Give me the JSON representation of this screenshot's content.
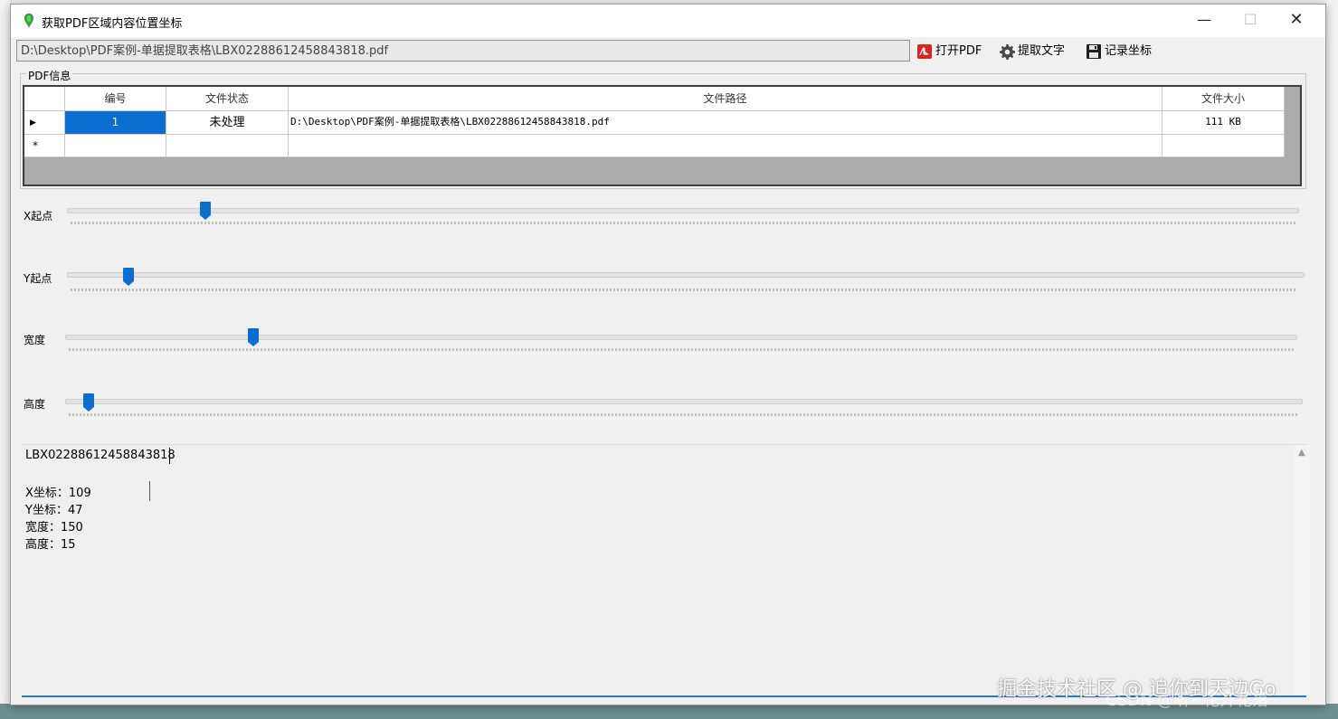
{
  "window": {
    "title": "获取PDF区域内容位置坐标",
    "minimize": "—",
    "maximize": "☐",
    "close": "✕"
  },
  "toolbar": {
    "path_value": "D:\\Desktop\\PDF案例-单据提取表格\\LBX02288612458843818.pdf",
    "open_label": "打开PDF",
    "extract_label": "提取文字",
    "record_label": "记录坐标"
  },
  "pdf_group": {
    "label": "PDF信息",
    "columns": [
      "编号",
      "文件状态",
      "文件路径",
      "文件大小"
    ],
    "rows": [
      {
        "id": "1",
        "status": "未处理",
        "path": "D:\\Desktop\\PDF案例-单据提取表格\\LBX02288612458843818.pdf",
        "size": "111 KB"
      }
    ],
    "new_row_marker": "*",
    "current_row_marker": "▶"
  },
  "sliders": {
    "x": {
      "label": "X起点",
      "value_fraction": 0.11
    },
    "y": {
      "label": "Y起点",
      "value_fraction": 0.05
    },
    "width": {
      "label": "宽度",
      "value_fraction": 0.15
    },
    "height": {
      "label": "高度",
      "value_fraction": 0.02
    }
  },
  "output": {
    "filename": "LBX02288612458843818",
    "lines": [
      "X坐标：109",
      "Y坐标：47",
      "宽度：150",
      "高度：15"
    ]
  },
  "watermark": {
    "text": "掘金技术社区 @ 追你到天边Go",
    "text2": "CSDN @听~花开花落"
  },
  "colors": {
    "accent": "#0a6ed1",
    "selection": "#0a6ed1",
    "bottom_line": "#2b78c5"
  }
}
